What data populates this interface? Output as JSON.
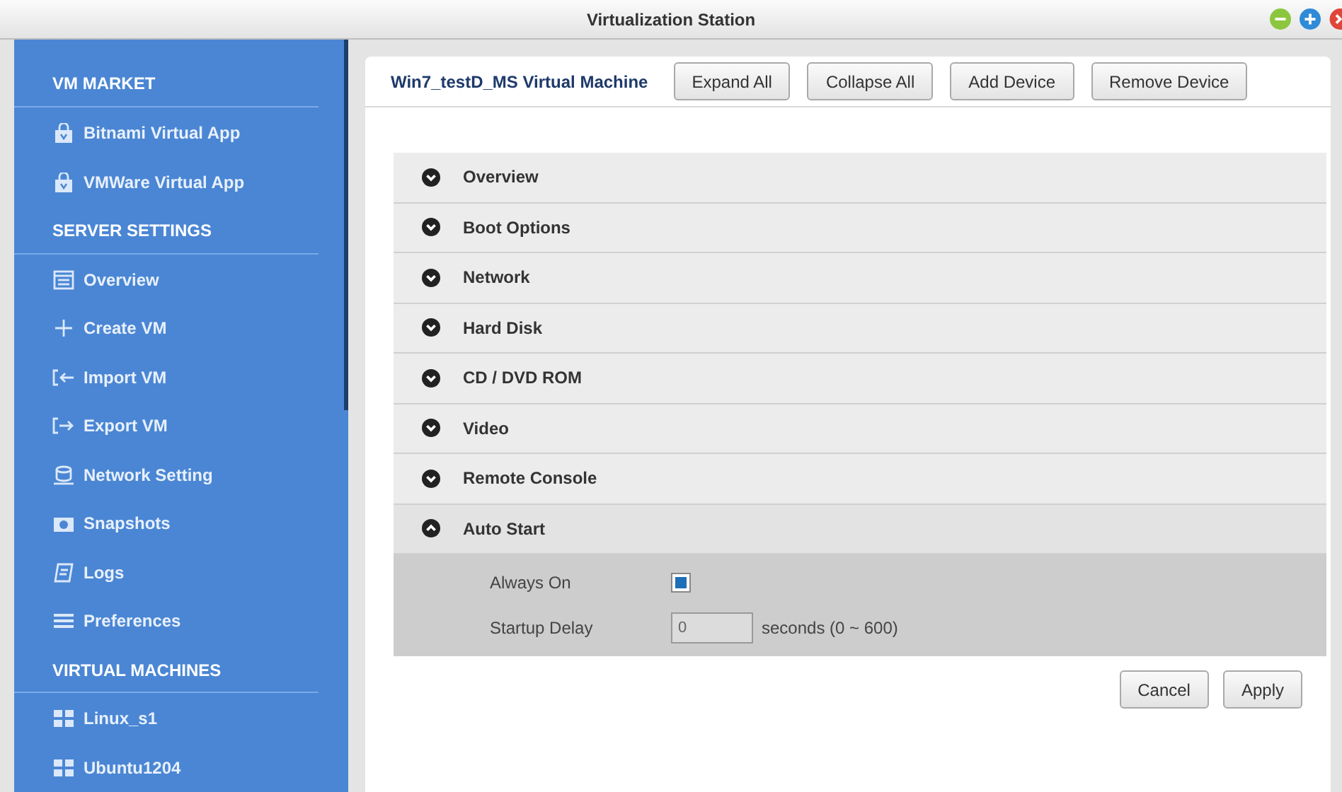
{
  "window": {
    "title": "Virtualization Station"
  },
  "sidebar": {
    "items": [
      {
        "kind": "header",
        "label": "VM MARKET"
      },
      {
        "kind": "item",
        "label": "Bitnami Virtual App"
      },
      {
        "kind": "item",
        "label": "VMWare Virtual App"
      },
      {
        "kind": "header",
        "label": "SERVER SETTINGS"
      },
      {
        "kind": "item",
        "label": "Overview"
      },
      {
        "kind": "item",
        "label": "Create VM"
      },
      {
        "kind": "item",
        "label": "Import VM"
      },
      {
        "kind": "item",
        "label": "Export VM"
      },
      {
        "kind": "item",
        "label": "Network Setting"
      },
      {
        "kind": "item",
        "label": "Snapshots"
      },
      {
        "kind": "item",
        "label": "Logs"
      },
      {
        "kind": "item",
        "label": "Preferences"
      },
      {
        "kind": "header",
        "label": "VIRTUAL MACHINES"
      },
      {
        "kind": "item",
        "label": "Linux_s1"
      },
      {
        "kind": "item",
        "label": "Ubuntu1204"
      }
    ]
  },
  "main": {
    "title": "Win7_testD_MS Virtual Machine",
    "toolbar": [
      "Expand All",
      "Collapse All",
      "Add Device",
      "Remove Device"
    ],
    "sections": [
      {
        "label": "Overview",
        "expanded": false
      },
      {
        "label": "Boot Options",
        "expanded": false
      },
      {
        "label": "Network",
        "expanded": false
      },
      {
        "label": "Hard Disk",
        "expanded": false
      },
      {
        "label": "CD / DVD ROM",
        "expanded": false
      },
      {
        "label": "Video",
        "expanded": false
      },
      {
        "label": "Remote Console",
        "expanded": false
      },
      {
        "label": "Auto Start",
        "expanded": true,
        "fields": [
          {
            "kind": "checkbox",
            "label": "Always On",
            "checked": true
          },
          {
            "kind": "number",
            "label": "Startup Delay",
            "value": "0",
            "unit": "seconds (0 ~ 600)"
          }
        ]
      }
    ],
    "buttons": [
      "Cancel",
      "Apply"
    ]
  }
}
